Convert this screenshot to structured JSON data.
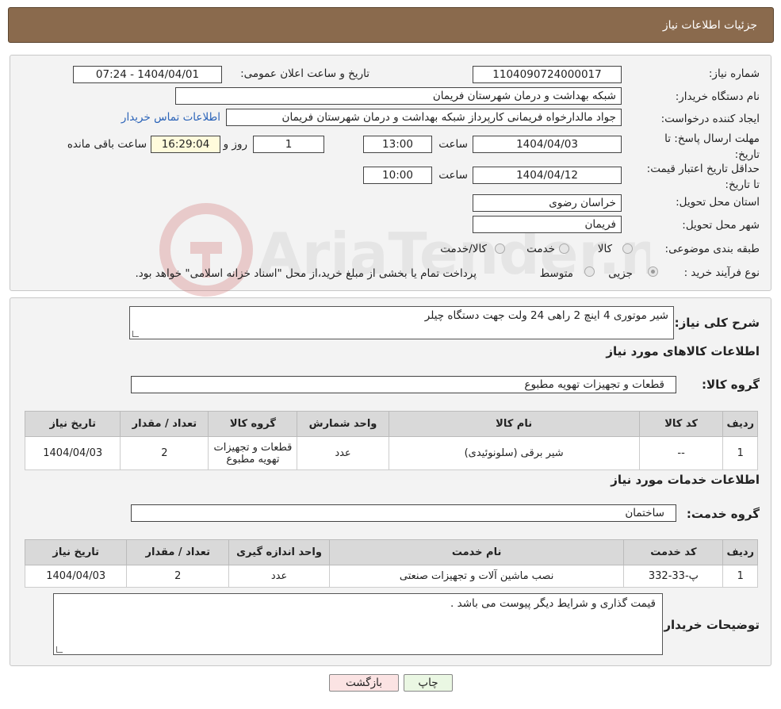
{
  "header": {
    "title": "جزئیات اطلاعات نیاز"
  },
  "info": {
    "need_number_label": "شماره نیاز:",
    "need_number": "1104090724000017",
    "announce_label": "تاریخ و ساعت اعلان عمومی:",
    "announce_value": "1404/04/01 - 07:24",
    "buyer_org_label": "نام دستگاه خریدار:",
    "buyer_org": "شبکه بهداشت و درمان شهرستان فریمان",
    "creator_label": "ایجاد کننده درخواست:",
    "creator": "جواد مالدارخواه فریمانی کارپرداز شبکه بهداشت و درمان شهرستان فریمان",
    "contact_link": "اطلاعات تماس خریدار",
    "deadline_label": "مهلت ارسال پاسخ: تا تاریخ:",
    "deadline_date": "1404/04/03",
    "time_label": "ساعت",
    "deadline_time": "13:00",
    "days": "1",
    "days_label": "روز و",
    "remaining_time": "16:29:04",
    "remaining_label": "ساعت باقی مانده",
    "validity_label": "حداقل تاریخ اعتبار قیمت: تا تاریخ:",
    "validity_date": "1404/04/12",
    "validity_time": "10:00",
    "province_label": "استان محل تحویل:",
    "province": "خراسان رضوی",
    "city_label": "شهر محل تحویل:",
    "city": "فریمان",
    "category_label": "طبقه بندی موضوعی:",
    "category_options": [
      "کالا",
      "خدمت",
      "کالا/خدمت"
    ],
    "process_label": "نوع فرآیند خرید :",
    "process_options": [
      "جزیی",
      "متوسط"
    ],
    "process_note": "پرداخت تمام یا بخشی از مبلغ خرید،از محل \"اسناد خزانه اسلامی\" خواهد بود."
  },
  "description": {
    "label": "شرح کلی نیاز:",
    "text": "شیر موتوری 4 اینچ 2 راهی 24 ولت جهت دستگاه چیلر"
  },
  "goods": {
    "section_title": "اطلاعات کالاهای مورد نیاز",
    "group_label": "گروه کالا:",
    "group_value": "قطعات و تجهیزات تهویه مطبوع",
    "columns": [
      "ردیف",
      "کد کالا",
      "نام کالا",
      "واحد شمارش",
      "گروه کالا",
      "تعداد / مقدار",
      "تاریخ نیاز"
    ],
    "rows": [
      [
        "1",
        "--",
        "شیر برقی (سلونوئیدی)",
        "عدد",
        "قطعات و تجهیزات تهویه مطبوع",
        "2",
        "1404/04/03"
      ]
    ]
  },
  "services": {
    "section_title": "اطلاعات خدمات مورد نیاز",
    "group_label": "گروه خدمت:",
    "group_value": "ساختمان",
    "columns": [
      "ردیف",
      "کد خدمت",
      "نام خدمت",
      "واحد اندازه گیری",
      "تعداد / مقدار",
      "تاریخ نیاز"
    ],
    "rows": [
      [
        "1",
        "پ-33-332",
        "نصب ماشین آلات و تجهیزات صنعتی",
        "عدد",
        "2",
        "1404/04/03"
      ]
    ]
  },
  "buyer_notes": {
    "label": "توضیحات خریدار:",
    "text": "قیمت گذاری و شرایط دیگر پیوست می باشد ."
  },
  "buttons": {
    "print": "چاپ",
    "back": "بازگشت"
  },
  "watermark": {
    "text": "AriaTender.net"
  }
}
